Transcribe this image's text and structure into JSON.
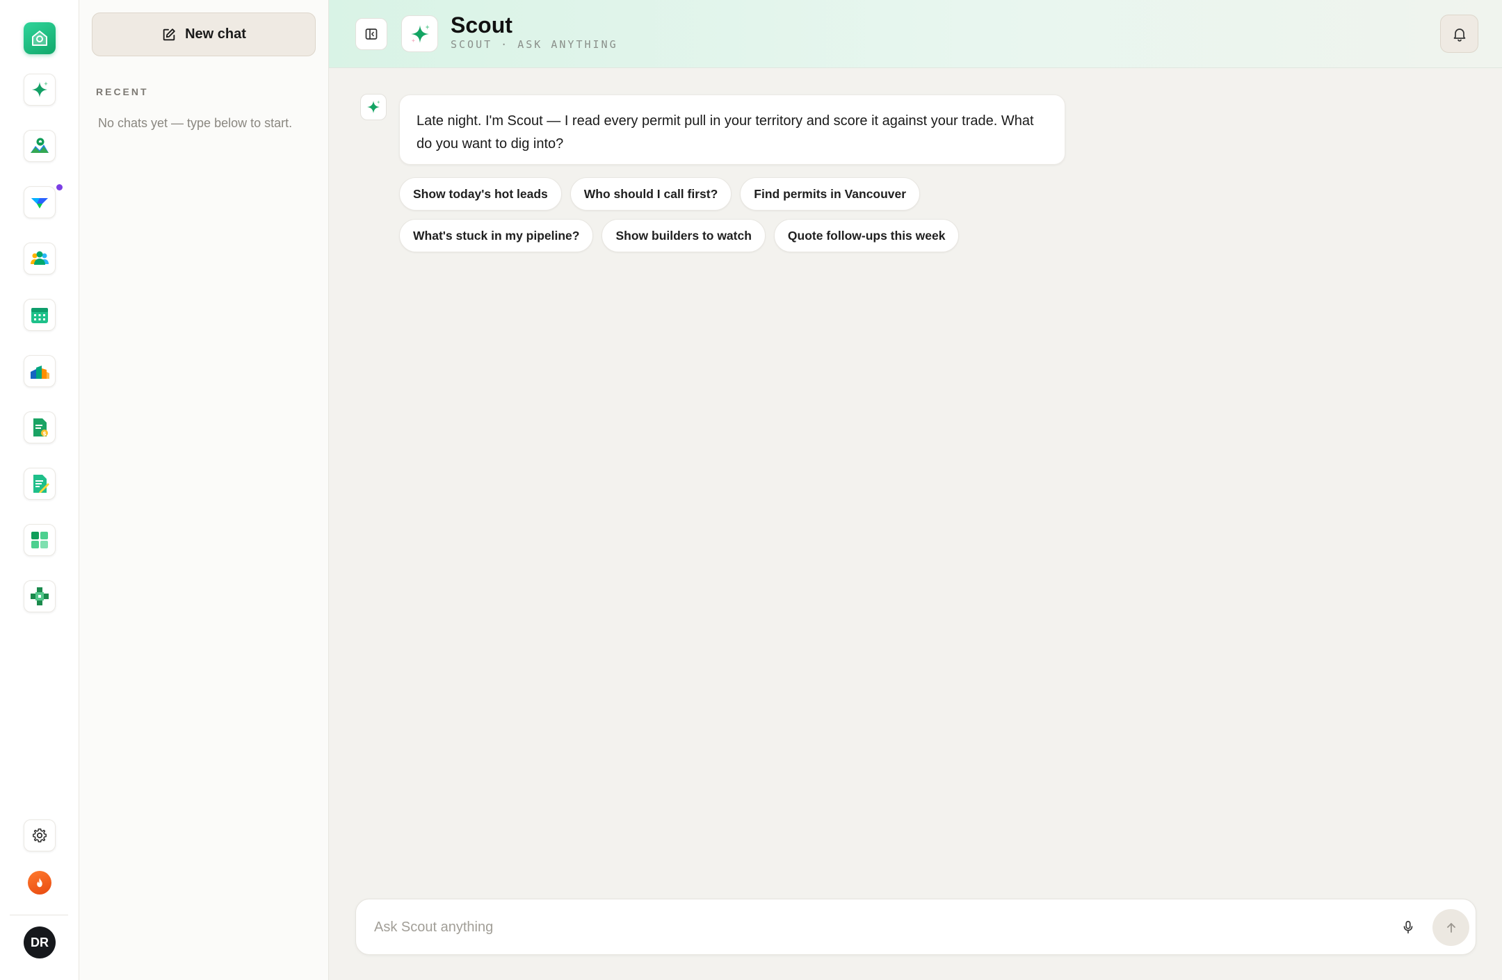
{
  "nav": {
    "items": [
      {
        "icon": "home-icon",
        "label": "Home"
      },
      {
        "icon": "scout-sparkle-icon",
        "label": "Scout"
      },
      {
        "icon": "map-icon",
        "label": "Map"
      },
      {
        "icon": "funnel-icon",
        "label": "Pipeline"
      },
      {
        "icon": "people-icon",
        "label": "Contacts"
      },
      {
        "icon": "calendar-icon",
        "label": "Calendar"
      },
      {
        "icon": "analytics-icon",
        "label": "Analytics"
      },
      {
        "icon": "invoice-icon",
        "label": "Invoices"
      },
      {
        "icon": "document-edit-icon",
        "label": "Documents"
      },
      {
        "icon": "apps-grid-icon",
        "label": "Apps"
      },
      {
        "icon": "integrations-icon",
        "label": "Integrations"
      }
    ],
    "settings_icon": "gear-icon",
    "streak_icon": "flame-icon",
    "user_initials": "DR"
  },
  "history": {
    "new_chat_label": "New chat",
    "recent_label": "RECENT",
    "empty_text": "No chats yet — type below to start."
  },
  "header": {
    "title": "Scout",
    "subtitle": "SCOUT · ASK ANYTHING"
  },
  "conversation": {
    "message": "Late night. I'm Scout — I read every permit pull in your territory and score it against your trade. What do you want to dig into?",
    "suggestions": [
      "Show today's hot leads",
      "Who should I call first?",
      "Find permits in Vancouver",
      "What's stuck in my pipeline?",
      "Show builders to watch",
      "Quote follow-ups this week"
    ]
  },
  "composer": {
    "placeholder": "Ask Scout anything",
    "value": ""
  },
  "colors": {
    "accent": "#11a86a",
    "notification_dot": "#7b3fe4",
    "streak": "#e84a10"
  }
}
